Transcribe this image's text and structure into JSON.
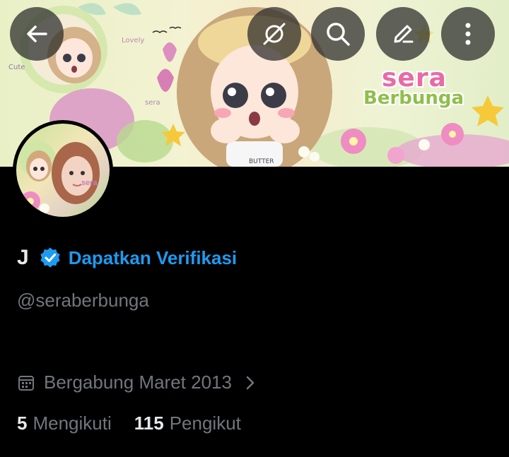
{
  "banner": {
    "title_line1": "sera",
    "title_line2": "Berbunga",
    "sticker_lovely": "Lovely",
    "sticker_cute": "Cute",
    "sticker_sera": "sera",
    "shirt_text": "BUTTER"
  },
  "toolbar": {
    "back_icon": "arrow-left-icon",
    "grok_icon": "grok-icon",
    "search_icon": "search-icon",
    "edit_icon": "pencil-icon",
    "more_icon": "more-vertical-icon"
  },
  "profile": {
    "avatar_badge": "sera",
    "name": "J",
    "verify_label": "Dapatkan Verifikasi",
    "handle": "@seraberbunga",
    "joined": "Bergabung Maret 2013",
    "following_count": "5",
    "following_label": "Mengikuti",
    "followers_count": "115",
    "followers_label": "Pengikut"
  },
  "colors": {
    "background": "#000000",
    "accent": "#1d9bf0",
    "muted": "#71767b",
    "primary_text": "#e7e9ea"
  }
}
